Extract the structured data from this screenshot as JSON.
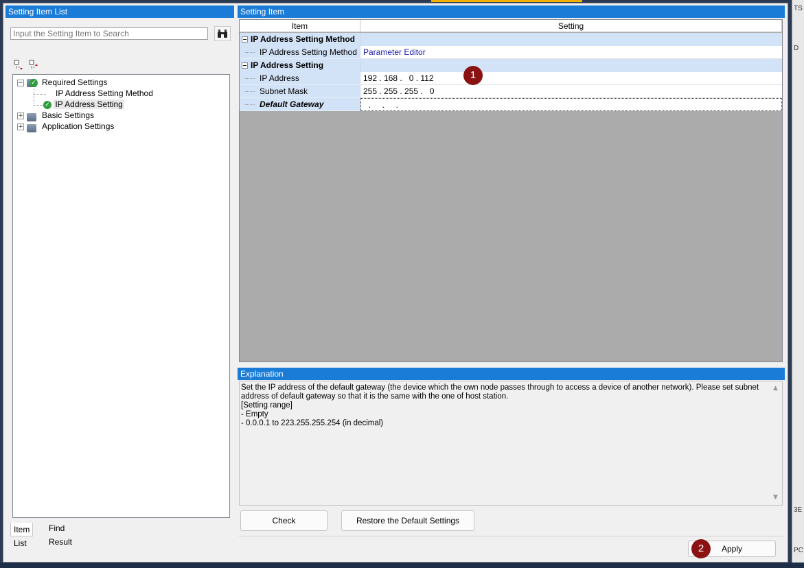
{
  "left_panel": {
    "title": "Setting Item List",
    "search_placeholder": "Input the Setting Item to Search",
    "tree": {
      "required": "Required Settings",
      "ip_method": "IP Address Setting Method",
      "ip_setting": "IP Address Setting",
      "basic": "Basic Settings",
      "application": "Application Settings"
    },
    "tabs": {
      "item_list": "Item List",
      "find_result": "Find Result"
    }
  },
  "setting_item": {
    "title": "Setting Item",
    "headers": {
      "item": "Item",
      "setting": "Setting"
    },
    "rows": {
      "cat_method": "IP Address Setting Method",
      "method_label": "IP Address Setting Method",
      "method_value": "Parameter Editor",
      "cat_ip": "IP Address Setting",
      "ip_label": "IP Address",
      "ip_value": "192 . 168 .   0 . 112",
      "mask_label": "Subnet Mask",
      "mask_value": "255 . 255 . 255 .   0",
      "gateway_label": "Default Gateway",
      "gateway_value": "  .     .     ."
    }
  },
  "explanation": {
    "title": "Explanation",
    "lines": [
      "Set the IP address of the default gateway (the device which the own node passes through to access a device of another network). Please set subnet address of default gateway so that it is the same with the one of host station.",
      "[Setting range]",
      "- Empty",
      "- 0.0.0.1 to 223.255.255.254 (in decimal)"
    ]
  },
  "buttons": {
    "check": "Check",
    "restore": "Restore the Default Settings",
    "apply": "Apply"
  },
  "badges": {
    "one": "1",
    "two": "2"
  },
  "side_app": {
    "a": "TS",
    "b": "D",
    "c": "3E",
    "d": "PC"
  },
  "colors": {
    "title_bar": "#1b7cd8",
    "category_bg": "#d3e3f7",
    "badge": "#8b1212"
  },
  "icons": [
    "binoculars-icon",
    "expand-all-icon",
    "collapse-all-icon",
    "check-icon",
    "folder-icon"
  ]
}
